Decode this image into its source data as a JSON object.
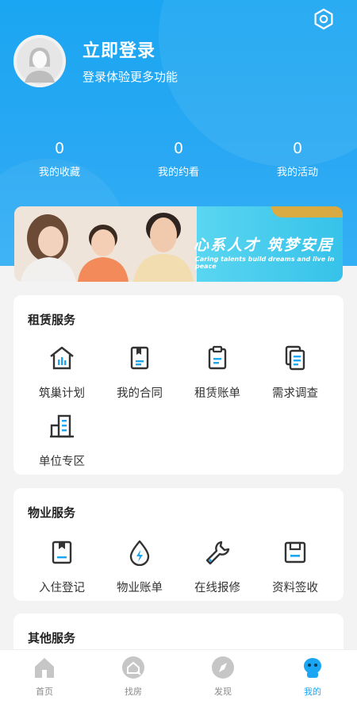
{
  "header": {
    "login_title": "立即登录",
    "login_subtitle": "登录体验更多功能",
    "stats": [
      {
        "value": "0",
        "label": "我的收藏"
      },
      {
        "value": "0",
        "label": "我的约看"
      },
      {
        "value": "0",
        "label": "我的活动"
      }
    ]
  },
  "banner": {
    "slogan": "心系人才 筑梦安居",
    "slogan_en": "Caring talents build dreams and live in peace"
  },
  "rental": {
    "title": "租赁服务",
    "items": [
      {
        "label": "筑巢计划",
        "icon": "house-icon"
      },
      {
        "label": "我的合同",
        "icon": "contract-icon"
      },
      {
        "label": "租赁账单",
        "icon": "bill-icon"
      },
      {
        "label": "需求调查",
        "icon": "survey-icon"
      },
      {
        "label": "单位专区",
        "icon": "building-icon"
      }
    ]
  },
  "property": {
    "title": "物业服务",
    "items": [
      {
        "label": "入住登记",
        "icon": "checkin-icon"
      },
      {
        "label": "物业账单",
        "icon": "utility-icon"
      },
      {
        "label": "在线报修",
        "icon": "wrench-icon"
      },
      {
        "label": "资料签收",
        "icon": "save-icon"
      }
    ]
  },
  "other": {
    "title": "其他服务"
  },
  "tabbar": [
    {
      "label": "首页",
      "icon": "home-icon"
    },
    {
      "label": "找房",
      "icon": "find-house-icon"
    },
    {
      "label": "发现",
      "icon": "compass-icon"
    },
    {
      "label": "我的",
      "icon": "robot-icon",
      "active": true
    }
  ],
  "colors": {
    "primary": "#1aa6f2",
    "accent": "#f5a623"
  }
}
